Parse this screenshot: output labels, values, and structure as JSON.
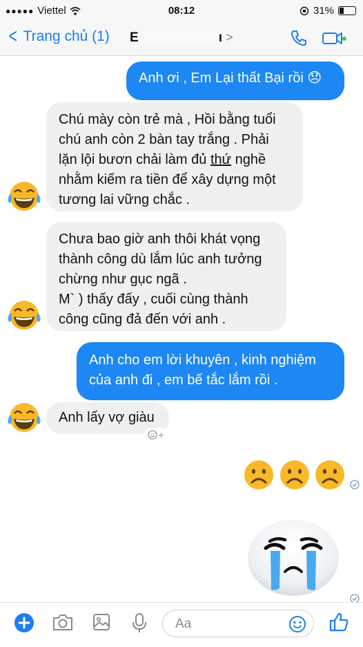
{
  "status_bar": {
    "signal_dots": "●●●●●",
    "carrier": "Viettel",
    "time": "08:12",
    "battery_percent": "31%",
    "battery_level": 0.31
  },
  "nav": {
    "back_label": "Trang chủ (1)",
    "contact_initial": "E",
    "contact_tail": "ı"
  },
  "messages": [
    {
      "dir": "out",
      "lines": [
        "Anh ơi , Em Lại thất Bại rồi 😞"
      ]
    },
    {
      "dir": "in",
      "lines": [
        "Chú mày còn trẻ mà , Hồi bằng tuổi",
        "chú anh còn 2 bàn tay trắng . Phải",
        "lặn lội bươn chải làm đủ ",
        "thứ",
        " nghề",
        "nhằm kiếm ra tiền để xây dựng một",
        "tương lai vững chắc ."
      ]
    },
    {
      "dir": "in",
      "lines": [
        "Chưa bao giờ anh thôi khát vọng",
        "thành công dù lắm lúc anh tưởng",
        "chừng như gục ngã .",
        "M` ) thấy đấy , cuối cùng thành",
        "công cũng đả đến với anh ."
      ]
    },
    {
      "dir": "out",
      "lines": [
        "Anh cho em lời khuyên , kinh nghiệm",
        "của anh đi , em bế tắc lắm rồi ."
      ]
    },
    {
      "dir": "in",
      "lines": [
        "Anh lấy vợ giàu"
      ]
    }
  ],
  "reaction_add": "+",
  "composer": {
    "placeholder": "Aa"
  },
  "colors": {
    "accent": "#1d87f3",
    "incoming": "#f0f0f0",
    "emoji_yellow": "#f7b928"
  }
}
